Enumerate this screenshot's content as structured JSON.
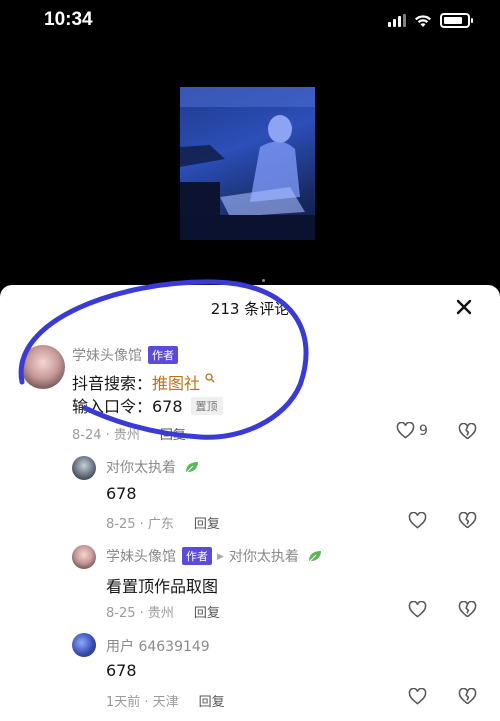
{
  "status": {
    "time": "10:34"
  },
  "sheet": {
    "title": "213 条评论"
  },
  "comments": [
    {
      "user": "学妹头像馆",
      "badge": "作者",
      "line1_prefix": "抖音搜索：",
      "line1_link": "推图社",
      "line2": "输入口令：678",
      "pinned": "置顶",
      "date_loc": "8-24 · 贵州",
      "reply": "回复",
      "likes": "9"
    },
    {
      "user": "对你太执着",
      "text": "678",
      "date_loc": "8-25 · 广东",
      "reply": "回复"
    },
    {
      "user": "学妹头像馆",
      "badge": "作者",
      "reply_to": "对你太执着",
      "text": "看置顶作品取图",
      "date_loc": "8-25 · 贵州",
      "reply": "回复"
    },
    {
      "user": "用户 64639149",
      "text": "678",
      "date_loc": "1天前 · 天津",
      "reply": "回复"
    }
  ],
  "colors": {
    "author_badge": "#5b4bd8",
    "link": "#b8741a",
    "annotation": "#3a3ad4"
  }
}
